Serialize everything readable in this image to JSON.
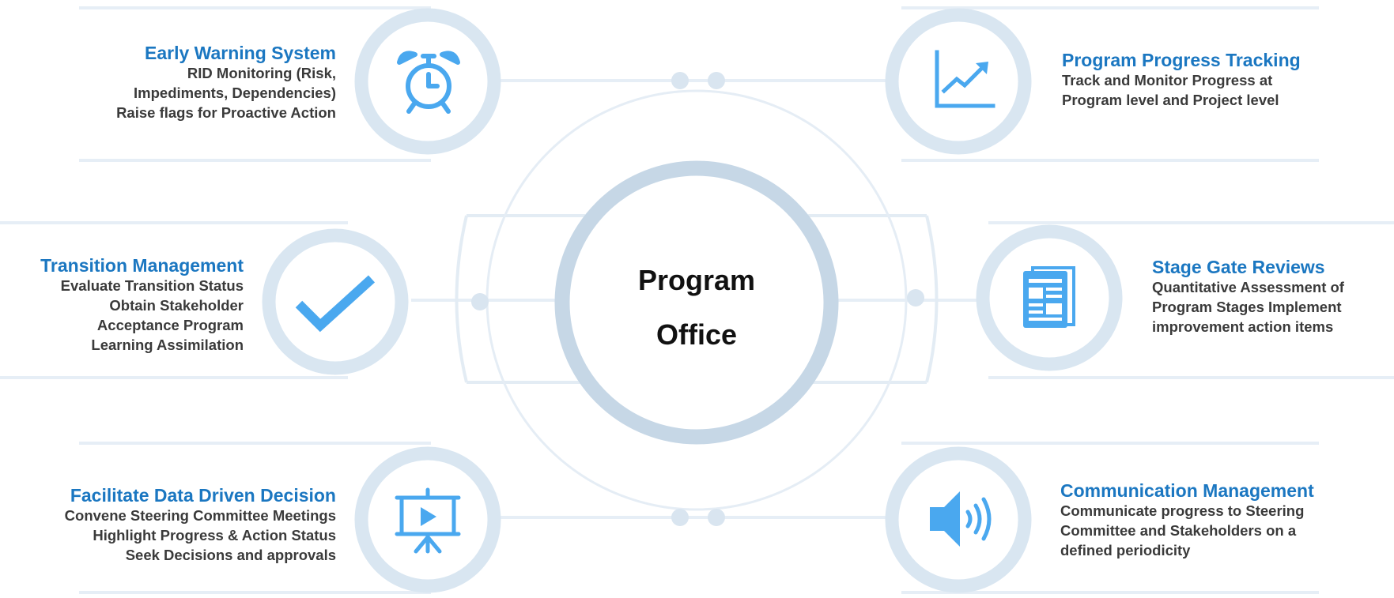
{
  "center": {
    "line1": "Program",
    "line2": "Office"
  },
  "colors": {
    "accent": "#1b77c1",
    "icon": "#4aa8ef",
    "ring": "#d9e6f1",
    "center_ring": "#c6d7e6"
  },
  "items": {
    "early_warning": {
      "title": "Early Warning System",
      "lines": [
        "RID Monitoring (Risk,",
        "Impediments, Dependencies)",
        "Raise flags for Proactive Action"
      ],
      "icon": "alarm-clock-icon"
    },
    "transition": {
      "title": "Transition Management",
      "lines": [
        "Evaluate Transition Status",
        "Obtain Stakeholder",
        "Acceptance Program",
        "Learning Assimilation"
      ],
      "icon": "checkmark-icon"
    },
    "data_driven": {
      "title": "Facilitate Data Driven Decision",
      "lines": [
        "Convene Steering Committee Meetings",
        "Highlight Progress & Action Status",
        "Seek Decisions and approvals"
      ],
      "icon": "presentation-icon"
    },
    "progress": {
      "title": "Program Progress Tracking",
      "lines": [
        "Track and Monitor Progress at",
        "Program level and Project level"
      ],
      "icon": "line-chart-icon"
    },
    "stage_gate": {
      "title": "Stage Gate Reviews",
      "lines": [
        "Quantitative Assessment of",
        "Program Stages Implement",
        "improvement action items"
      ],
      "icon": "newspaper-icon"
    },
    "communication": {
      "title": "Communication Management",
      "lines": [
        "Communicate progress to Steering",
        "Committee and Stakeholders on a",
        "defined periodicity"
      ],
      "icon": "speaker-icon"
    }
  }
}
